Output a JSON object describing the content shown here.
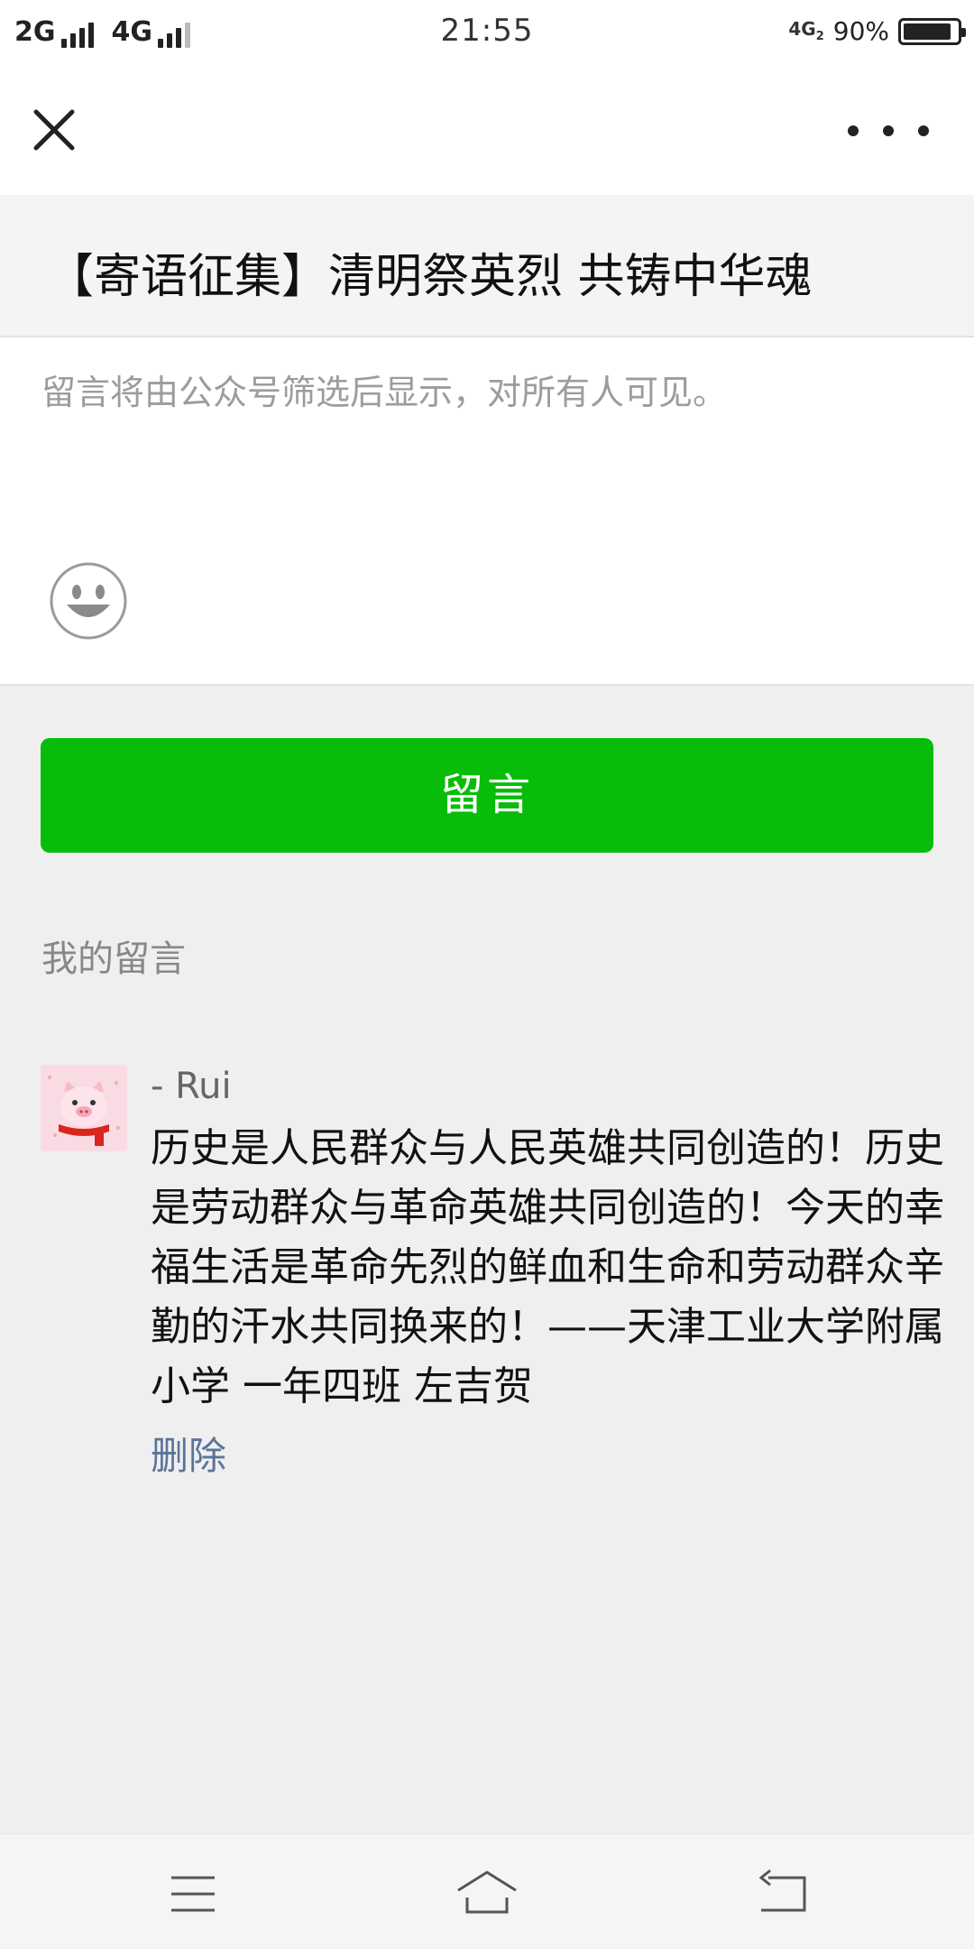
{
  "status_bar": {
    "network_left_1": "2G",
    "network_left_2": "4G",
    "time": "21:55",
    "network_right": "4G",
    "network_right_sub": "2",
    "battery_text": "90%",
    "battery_level": 0.9
  },
  "nav": {
    "close_icon": "close-icon",
    "more_icon": "more-horizontal-icon"
  },
  "article": {
    "title": "【寄语征集】清明祭英烈 共铸中华魂"
  },
  "compose": {
    "placeholder": "留言将由公众号筛选后显示，对所有人可见。",
    "emoji_icon": "smiley-face-icon"
  },
  "submit": {
    "label": "留言",
    "color": "#08bd09"
  },
  "my_comments": {
    "label": "我的留言",
    "items": [
      {
        "nickname": "- Rui",
        "text": "历史是人民群众与人民英雄共同创造的！历史是劳动群众与革命英雄共同创造的！今天的幸福生活是革命先烈的鲜血和生命和劳动群众辛勤的汗水共同换来的！——天津工业大学附属小学 一年四班 左吉贺",
        "delete_label": "删除"
      }
    ]
  },
  "system_nav": {
    "menu_icon": "menu-icon",
    "home_icon": "home-icon",
    "back_icon": "back-icon"
  }
}
